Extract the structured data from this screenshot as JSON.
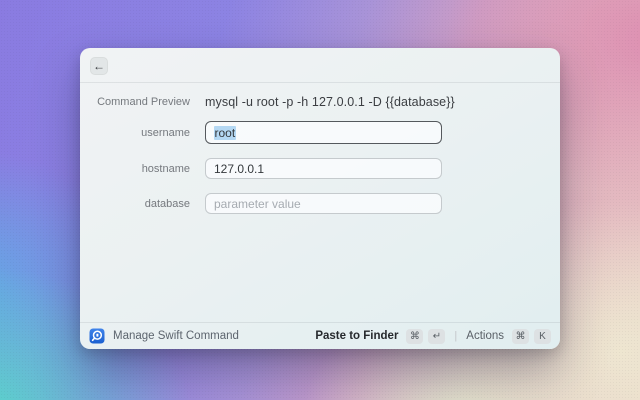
{
  "window": {
    "header": {
      "back_icon": "←"
    },
    "form": {
      "preview": {
        "label": "Command Preview",
        "value": "mysql -u root -p -h 127.0.0.1 -D {{database}}"
      },
      "fields": [
        {
          "label": "username",
          "value": "root",
          "placeholder": "",
          "state": "focused-selected"
        },
        {
          "label": "hostname",
          "value": "127.0.0.1",
          "placeholder": "",
          "state": "normal"
        },
        {
          "label": "database",
          "value": "",
          "placeholder": "parameter value",
          "state": "empty"
        }
      ]
    },
    "footer": {
      "app_icon": "swift-command-icon",
      "app_name": "Manage Swift Command",
      "primary_action": {
        "label": "Paste to Finder",
        "keys": [
          "⌘",
          "↵"
        ]
      },
      "separator": "|",
      "secondary_action": {
        "label": "Actions",
        "keys": [
          "⌘",
          "K"
        ]
      }
    }
  },
  "colors": {
    "accent_blue_icon": "#2468d8",
    "selection_highlight": "#b4d8f3",
    "focused_border": "#55595d",
    "input_border": "#c5cacd",
    "bg_purple": "#8a7be1",
    "bg_pink": "#dd8ab0",
    "bg_teal": "#55dcc9",
    "bg_cream": "#eee7d1"
  }
}
